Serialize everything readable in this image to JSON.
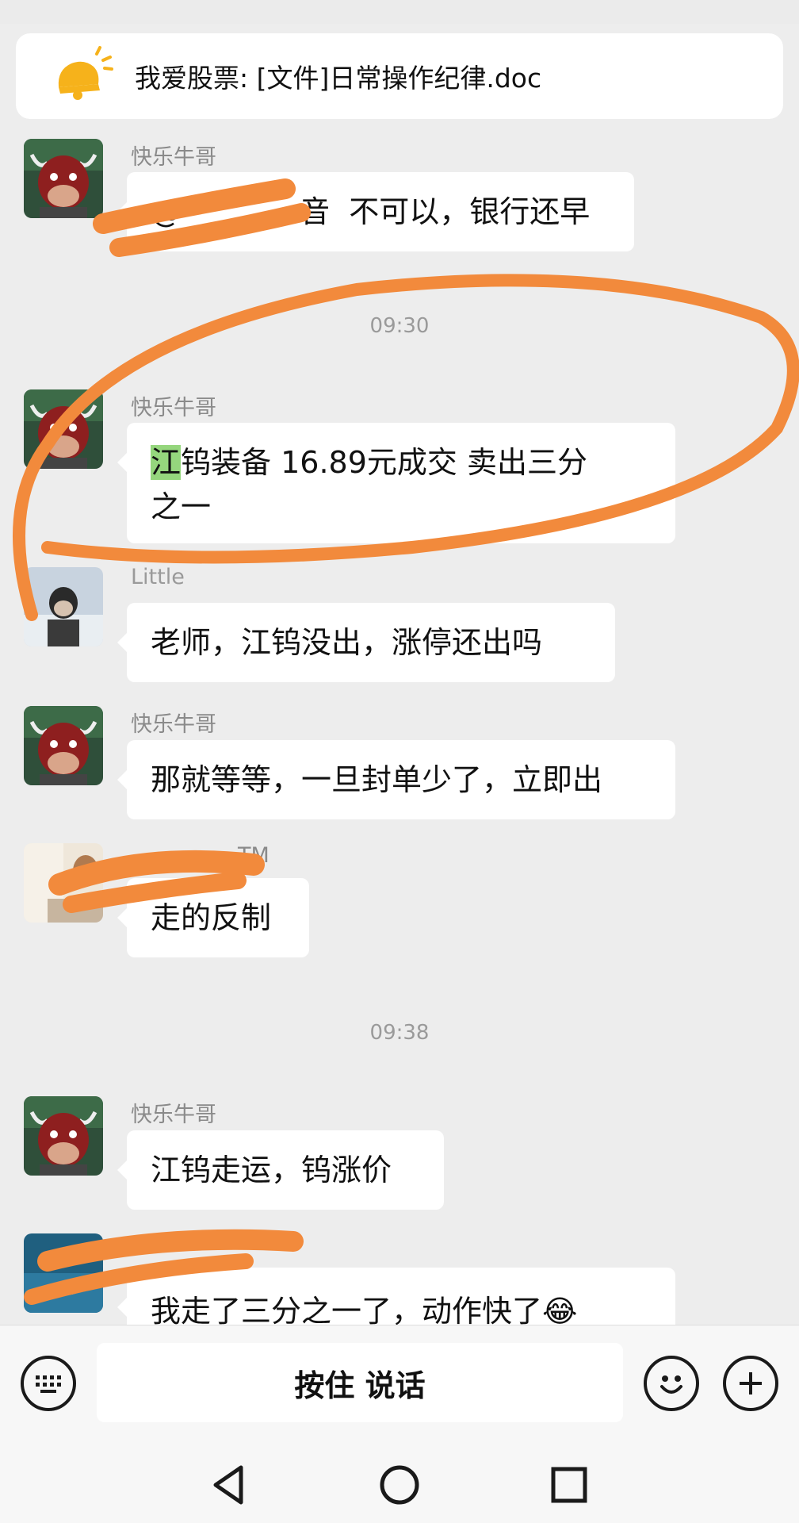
{
  "pinned": {
    "text": "我爱股票: [文件]日常操作纪律.doc",
    "icon": "bell-icon"
  },
  "times": [
    "09:30",
    "09:38"
  ],
  "messages": [
    {
      "name": "快乐牛哥",
      "text": "不可以，银行还早",
      "partial_prefix": "@",
      "partial_suffix": "音"
    },
    {
      "name": "快乐牛哥",
      "highlight": "江",
      "text": "钨装备  16.89元成交  卖出三分",
      "line2": "之一"
    },
    {
      "name": "Little",
      "text": "老师，江钨没出，涨停还出吗"
    },
    {
      "name": "快乐牛哥",
      "text": "那就等等，一旦封单少了，立即出"
    },
    {
      "name": "TM",
      "text": "走的反制"
    },
    {
      "name": "快乐牛哥",
      "text": "江钨走运，钨涨价"
    },
    {
      "name": "",
      "text": "我走了三分之一了，动作快了",
      "emoji": "😂"
    }
  ],
  "input": {
    "voice_label": "按住 说话",
    "keyboard_icon": "keyboard-icon",
    "emoji_icon": "emoji-icon",
    "plus_icon": "plus-icon"
  },
  "nav": [
    "back-icon",
    "home-icon",
    "recents-icon"
  ],
  "colors": {
    "background": "#ededed",
    "bubble": "#ffffff",
    "highlight": "#95d67d",
    "scribble": "#f28a3c"
  }
}
